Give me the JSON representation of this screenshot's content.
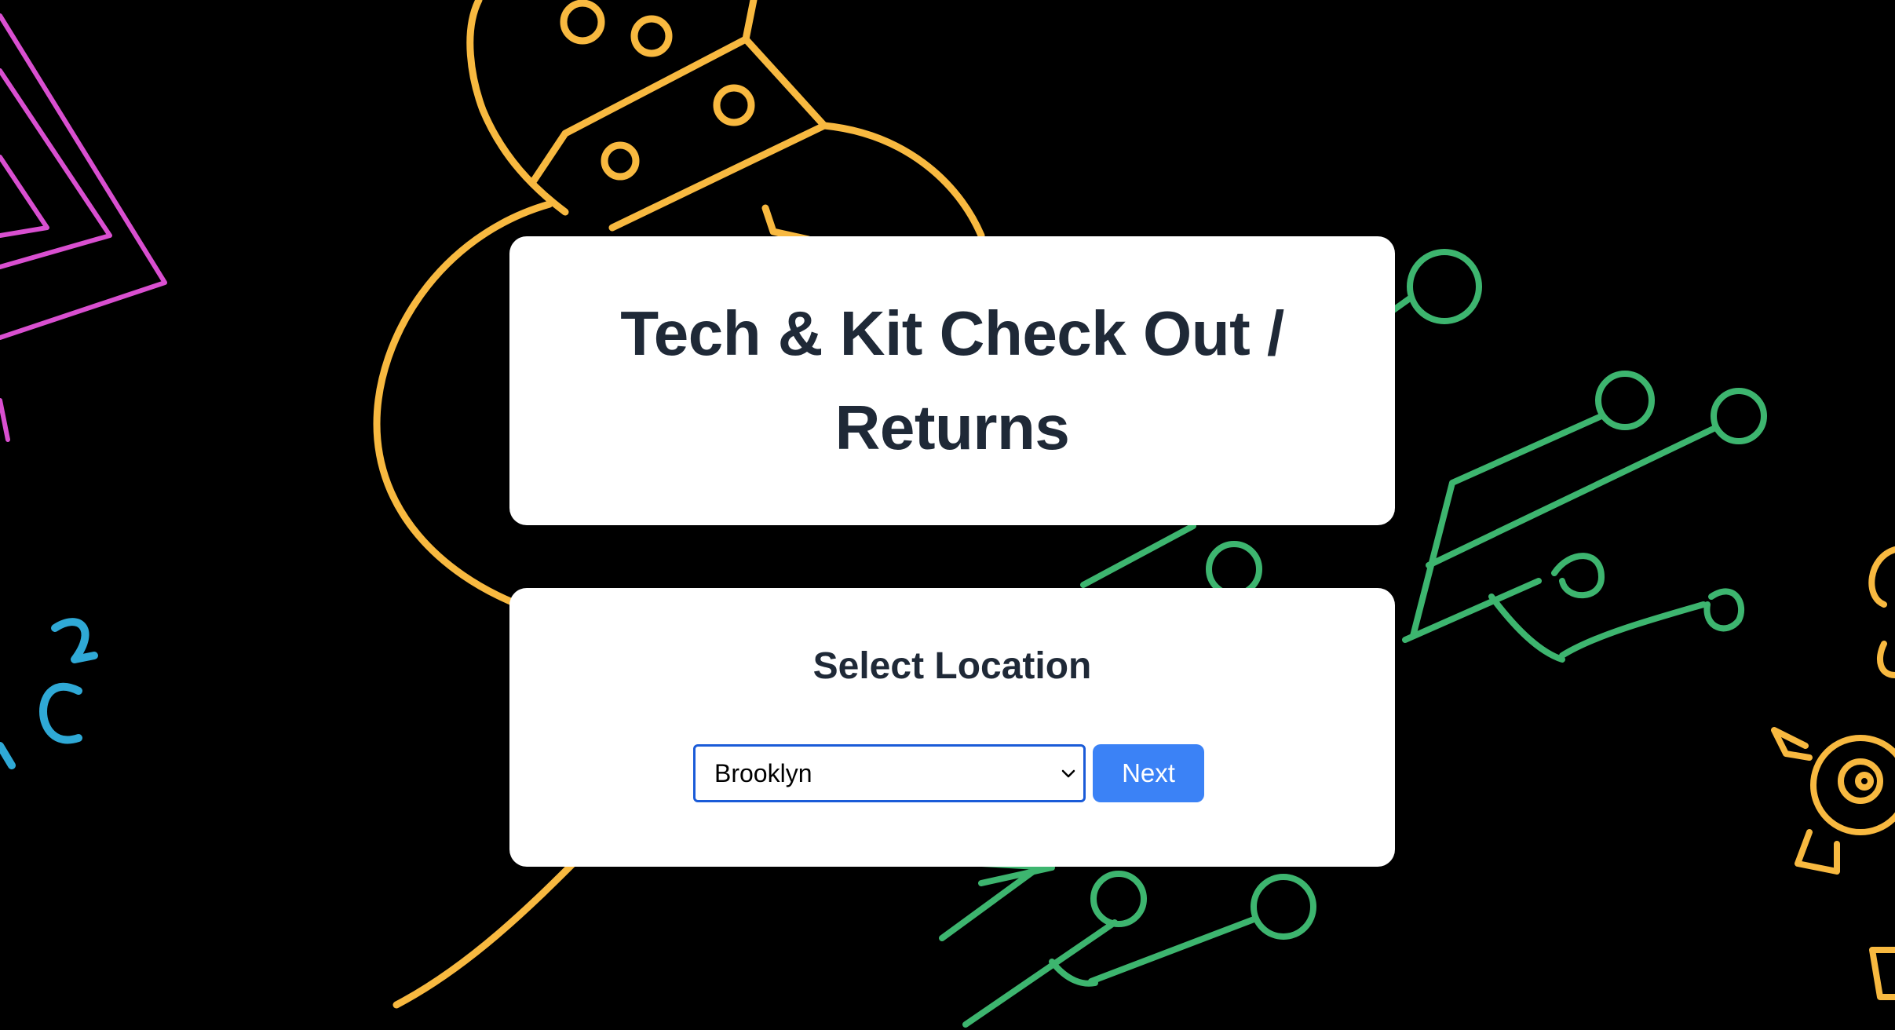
{
  "page": {
    "title": "Tech & Kit Check Out / Returns"
  },
  "location": {
    "heading": "Select Location",
    "selected": "Brooklyn",
    "next_label": "Next"
  },
  "colors": {
    "background": "#000000",
    "card": "#ffffff",
    "heading_text": "#1f2937",
    "button": "#3b82f6",
    "select_border": "#1a5bd8",
    "doodle_yellow": "#f8b940",
    "doodle_green": "#3db56f",
    "doodle_pink": "#d94fd0",
    "doodle_blue": "#2fa9d6"
  },
  "icons": {
    "select_arrow": "chevron-down-icon"
  }
}
